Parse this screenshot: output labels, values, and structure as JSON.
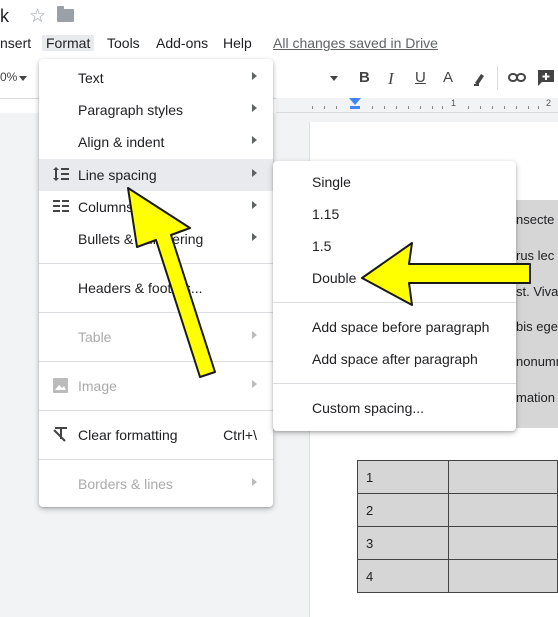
{
  "title_bar": {
    "doc_title": "k"
  },
  "menubar": {
    "items": [
      "nsert",
      "Format",
      "Tools",
      "Add-ons",
      "Help"
    ],
    "saved_status": "All changes saved in Drive"
  },
  "toolbar": {
    "zoom": "0%",
    "bold": "B",
    "italic": "I",
    "underline": "U",
    "text_color": "A"
  },
  "ruler": {
    "num1": "1",
    "num2": "2"
  },
  "format_menu": {
    "items": [
      {
        "label": "Text",
        "submenu": true
      },
      {
        "label": "Paragraph styles",
        "submenu": true
      },
      {
        "label": "Align & indent",
        "submenu": true
      },
      {
        "label": "Line spacing",
        "submenu": true,
        "icon": "line-spacing-icon",
        "highlighted": true
      },
      {
        "label": "Columns",
        "submenu": true,
        "icon": "columns-icon"
      },
      {
        "label": "Bullets & numbering",
        "submenu": true
      },
      {
        "label": "Headers & footers..."
      },
      {
        "label": "Table",
        "submenu": true,
        "disabled": true
      },
      {
        "label": "Image",
        "submenu": true,
        "disabled": true,
        "icon": "image-icon"
      },
      {
        "label": "Clear formatting",
        "shortcut": "Ctrl+\\",
        "icon": "clear-formatting-icon"
      },
      {
        "label": "Borders & lines",
        "submenu": true,
        "disabled": true
      }
    ]
  },
  "line_spacing_menu": {
    "items": [
      "Single",
      "1.15",
      "1.5",
      "Double",
      "Add space before paragraph",
      "Add space after paragraph",
      "Custom spacing..."
    ]
  },
  "document": {
    "text_fragments": [
      "nsecte",
      "rus lec",
      "st. Viva",
      "bis ege",
      "nonumr",
      "mation"
    ],
    "table_rows": [
      "1",
      "2",
      "3",
      "4"
    ]
  },
  "colors": {
    "arrow": "#ffff00",
    "arrow_outline": "#1a1a1a",
    "shading": "#d6d6d6",
    "accent": "#4285f4"
  }
}
